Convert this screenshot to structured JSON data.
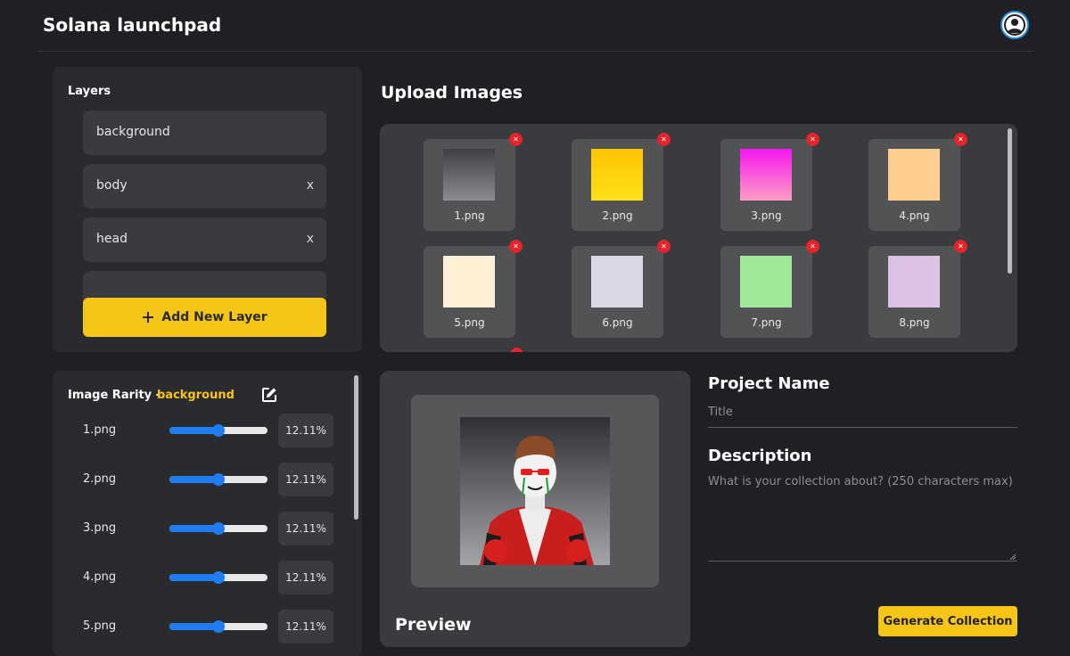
{
  "header": {
    "title": "Solana launchpad",
    "avatar_icon": "user-circle-icon"
  },
  "layers": {
    "title": "Layers",
    "items": [
      {
        "label": "background",
        "removable": false
      },
      {
        "label": "body",
        "removable": true,
        "remove_label": "x"
      },
      {
        "label": "head",
        "removable": true,
        "remove_label": "x"
      },
      {
        "label": "",
        "removable": false
      }
    ],
    "add_button": "Add New Layer"
  },
  "upload": {
    "title": "Upload Images",
    "images": [
      {
        "label": "1.png",
        "color": "#6e6f72"
      },
      {
        "label": "2.png",
        "color": "#ffd11a"
      },
      {
        "label": "3.png",
        "color": "#f33fd8"
      },
      {
        "label": "4.png",
        "color": "#ffcf8f"
      },
      {
        "label": "5.png",
        "color": "#fff0d6"
      },
      {
        "label": "6.png",
        "color": "#d9d8e6"
      },
      {
        "label": "7.png",
        "color": "#a1e89a"
      },
      {
        "label": "8.png",
        "color": "#dcc3e6"
      }
    ]
  },
  "rarity": {
    "title": "Image Rarity -",
    "layer": "background",
    "rows": [
      {
        "name": "1.png",
        "value": 50,
        "pct": "12.11%"
      },
      {
        "name": "2.png",
        "value": 50,
        "pct": "12.11%"
      },
      {
        "name": "3.png",
        "value": 50,
        "pct": "12.11%"
      },
      {
        "name": "4.png",
        "value": 50,
        "pct": "12.11%"
      },
      {
        "name": "5.png",
        "value": 50,
        "pct": "12.11%"
      }
    ]
  },
  "preview": {
    "label": "Preview"
  },
  "form": {
    "project_name_title": "Project Name",
    "title_placeholder": "Title",
    "description_title": "Description",
    "description_placeholder": "What is your collection about? (250 characters max)",
    "generate_button": "Generate Collection"
  },
  "colors": {
    "accent": "#f5c518",
    "slider": "#1e7df2",
    "remove": "#e3242b"
  }
}
